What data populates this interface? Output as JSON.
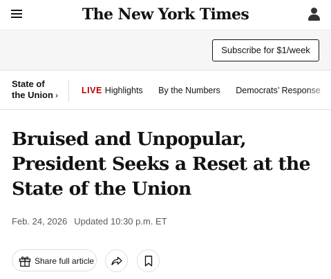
{
  "header": {
    "masthead": "The New York Times",
    "menu_icon": "hamburger-menu-icon",
    "account_icon": "account-icon"
  },
  "subscribe": {
    "label": "Subscribe for $1/week"
  },
  "subnav": {
    "section": {
      "line1": "State of",
      "line2": "the Union",
      "chevron": "›"
    },
    "live_badge": "LIVE",
    "items": [
      {
        "label": "Highlights"
      },
      {
        "label": "By the Numbers"
      },
      {
        "label": "Democrats’ Response"
      }
    ]
  },
  "article": {
    "headline": "Bruised and Unpopular, President Seeks a Reset at the State of the Union",
    "date": "Feb. 24, 2026",
    "updated": "Updated 10:30 p.m. ET"
  },
  "actions": {
    "share_full_article_label": "Share full article",
    "share_icon": "share-arrow-icon",
    "save_icon": "bookmark-icon",
    "gift_icon": "gift-icon"
  },
  "colors": {
    "live": "#b80000",
    "text": "#121212",
    "meta": "#5a5a5a",
    "subscribe_bar_bg": "#f6f6f6"
  }
}
